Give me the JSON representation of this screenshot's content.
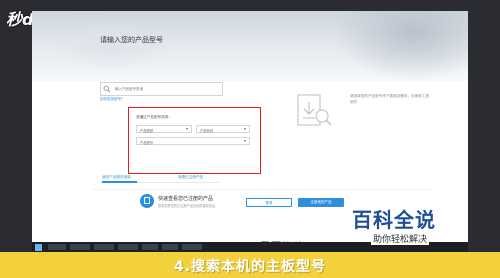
{
  "logo": {
    "text": "秒d◎ng视频"
  },
  "page": {
    "form_title": "请输入您的产品型号",
    "search_placeholder": "输入产品型号查询",
    "hint_link": "如何查找型号？",
    "select_section_label": "或通过产品型号选择：",
    "select_type": "产品类型",
    "select_series": "产品系列",
    "select_model": "产品型号",
    "tab_active": "我的产品服务指南",
    "tab_second": "查看已注册产品",
    "right_text": "请选择您的产品型号来下载驱动程序、手册和工具软件",
    "quick_title": "快速查看您已注册的产品",
    "quick_sub": "登录查看您的已注册产品及相关服务信息",
    "login_button": "登录",
    "register_button": "注册我的产品",
    "bottom_heading": "需要协助"
  },
  "watermark": {
    "title": "百科全说",
    "sub": "助你轻松解决"
  },
  "caption": {
    "text": "4.搜索本机的主板型号"
  },
  "colors": {
    "accent": "#2f8fdc",
    "highlight": "#e0201a",
    "caption_bg": "#f3d13c",
    "watermark": "#1e4f96"
  }
}
